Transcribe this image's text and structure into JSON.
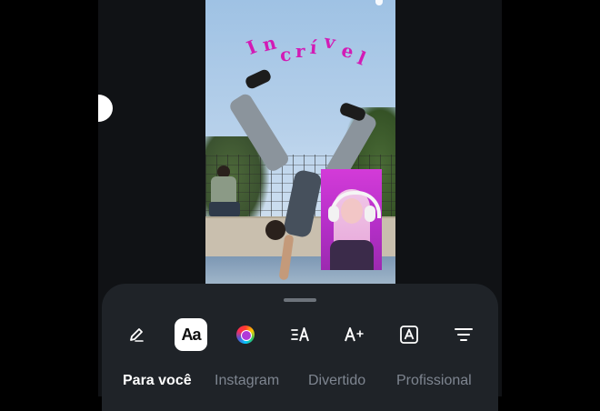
{
  "story_preview": {
    "sticker_text": "Incrível",
    "sticker_color": "#d21bb5"
  },
  "toolbar": {
    "tools": [
      {
        "name": "draw",
        "icon": "pen-icon"
      },
      {
        "name": "text",
        "icon": "text-style-icon",
        "label": "Aa",
        "active": true
      },
      {
        "name": "color",
        "icon": "color-wheel-icon"
      },
      {
        "name": "alignment",
        "icon": "text-align-icon"
      },
      {
        "name": "text-effects",
        "icon": "text-size-plus-icon"
      },
      {
        "name": "background",
        "icon": "text-background-icon"
      },
      {
        "name": "filters",
        "icon": "filter-lines-icon"
      }
    ]
  },
  "tabs": [
    {
      "label": "Para você",
      "active": true
    },
    {
      "label": "Instagram",
      "active": false
    },
    {
      "label": "Divertido",
      "active": false
    },
    {
      "label": "Profissional",
      "active": false
    }
  ],
  "colors": {
    "sheet_bg": "#1f2328",
    "app_bg": "#101215",
    "tab_active": "#ffffff",
    "tab_inactive": "#7e8590"
  }
}
